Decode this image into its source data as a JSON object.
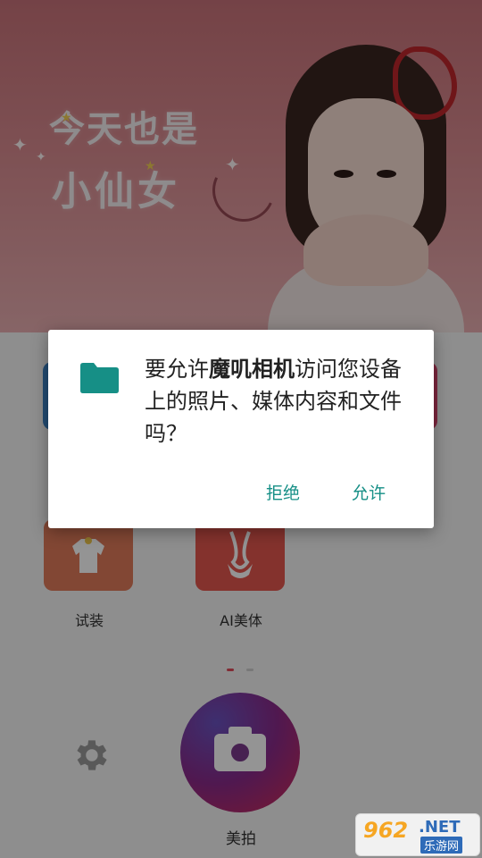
{
  "hero": {
    "line1": "今天也是",
    "line2": "小仙女"
  },
  "features": [
    {
      "label": "试装",
      "icon": "clothing-icon",
      "color": "#e07a5a"
    },
    {
      "label": "AI美体",
      "icon": "body-shape-icon",
      "color": "#e4574f"
    }
  ],
  "bottom_bar": {
    "shoot_label": "美拍",
    "settings_icon": "gear-icon"
  },
  "permission_dialog": {
    "message_prefix": "要允许",
    "app_name": "魔叽相机",
    "message_suffix": "访问您设备上的照片、媒体内容和文件吗？",
    "deny_label": "拒绝",
    "allow_label": "允许",
    "icon": "folder-icon",
    "accent_color": "#168f86"
  },
  "watermark": {
    "number": "962",
    "domain": ".NET",
    "site": "乐游网"
  }
}
